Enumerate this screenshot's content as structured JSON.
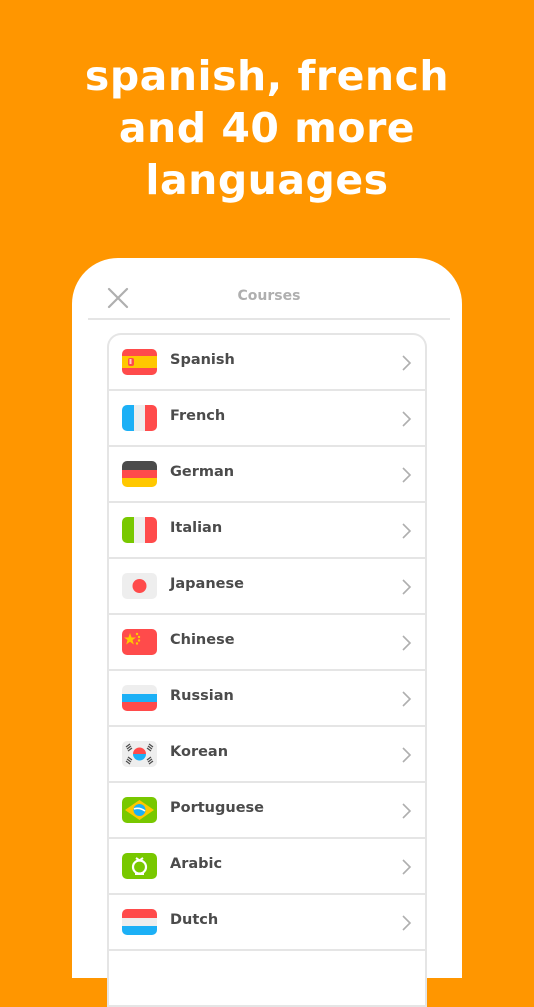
{
  "headline": {
    "lines": [
      "spanish, french",
      "and 40 more",
      "languages"
    ]
  },
  "colors": {
    "background": "#ff9600",
    "card": "#ffffff",
    "text": "#4b4b4b",
    "muted": "#afafaf",
    "border": "#e5e5e5"
  },
  "courses_dialog": {
    "title": "Courses",
    "close_icon": "close-icon",
    "items": [
      {
        "label": "Spanish",
        "flag": "spain-flag-icon"
      },
      {
        "label": "French",
        "flag": "france-flag-icon"
      },
      {
        "label": "German",
        "flag": "germany-flag-icon"
      },
      {
        "label": "Italian",
        "flag": "italy-flag-icon"
      },
      {
        "label": "Japanese",
        "flag": "japan-flag-icon"
      },
      {
        "label": "Chinese",
        "flag": "china-flag-icon"
      },
      {
        "label": "Russian",
        "flag": "russia-flag-icon"
      },
      {
        "label": "Korean",
        "flag": "korea-flag-icon"
      },
      {
        "label": "Portuguese",
        "flag": "brazil-flag-icon"
      },
      {
        "label": "Arabic",
        "flag": "arabic-flag-icon"
      },
      {
        "label": "Dutch",
        "flag": "netherlands-flag-icon"
      }
    ]
  }
}
